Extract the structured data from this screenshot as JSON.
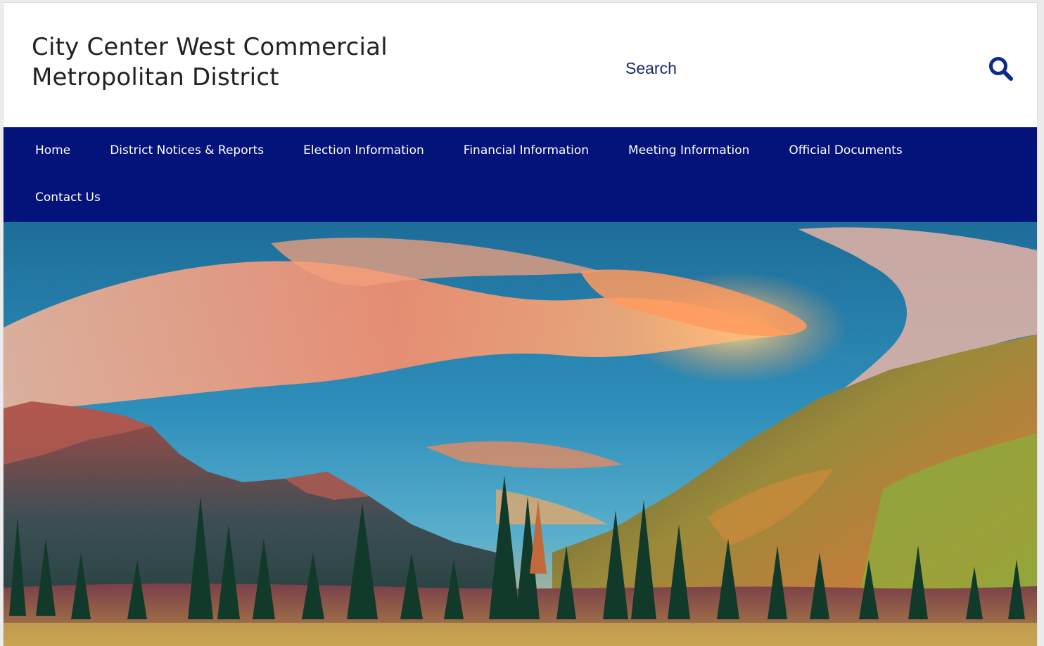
{
  "site": {
    "title": "City Center West Commercial Metropolitan District"
  },
  "search": {
    "placeholder": "Search",
    "icon": "search-icon"
  },
  "nav": {
    "items": [
      {
        "label": "Home"
      },
      {
        "label": "District Notices & Reports"
      },
      {
        "label": "Election Information"
      },
      {
        "label": "Financial Information"
      },
      {
        "label": "Meeting Information"
      },
      {
        "label": "Official Documents"
      },
      {
        "label": "Contact Us"
      }
    ]
  },
  "colors": {
    "nav_background": "#03137a",
    "accent": "#0b2a8c",
    "title_text": "#222222"
  }
}
